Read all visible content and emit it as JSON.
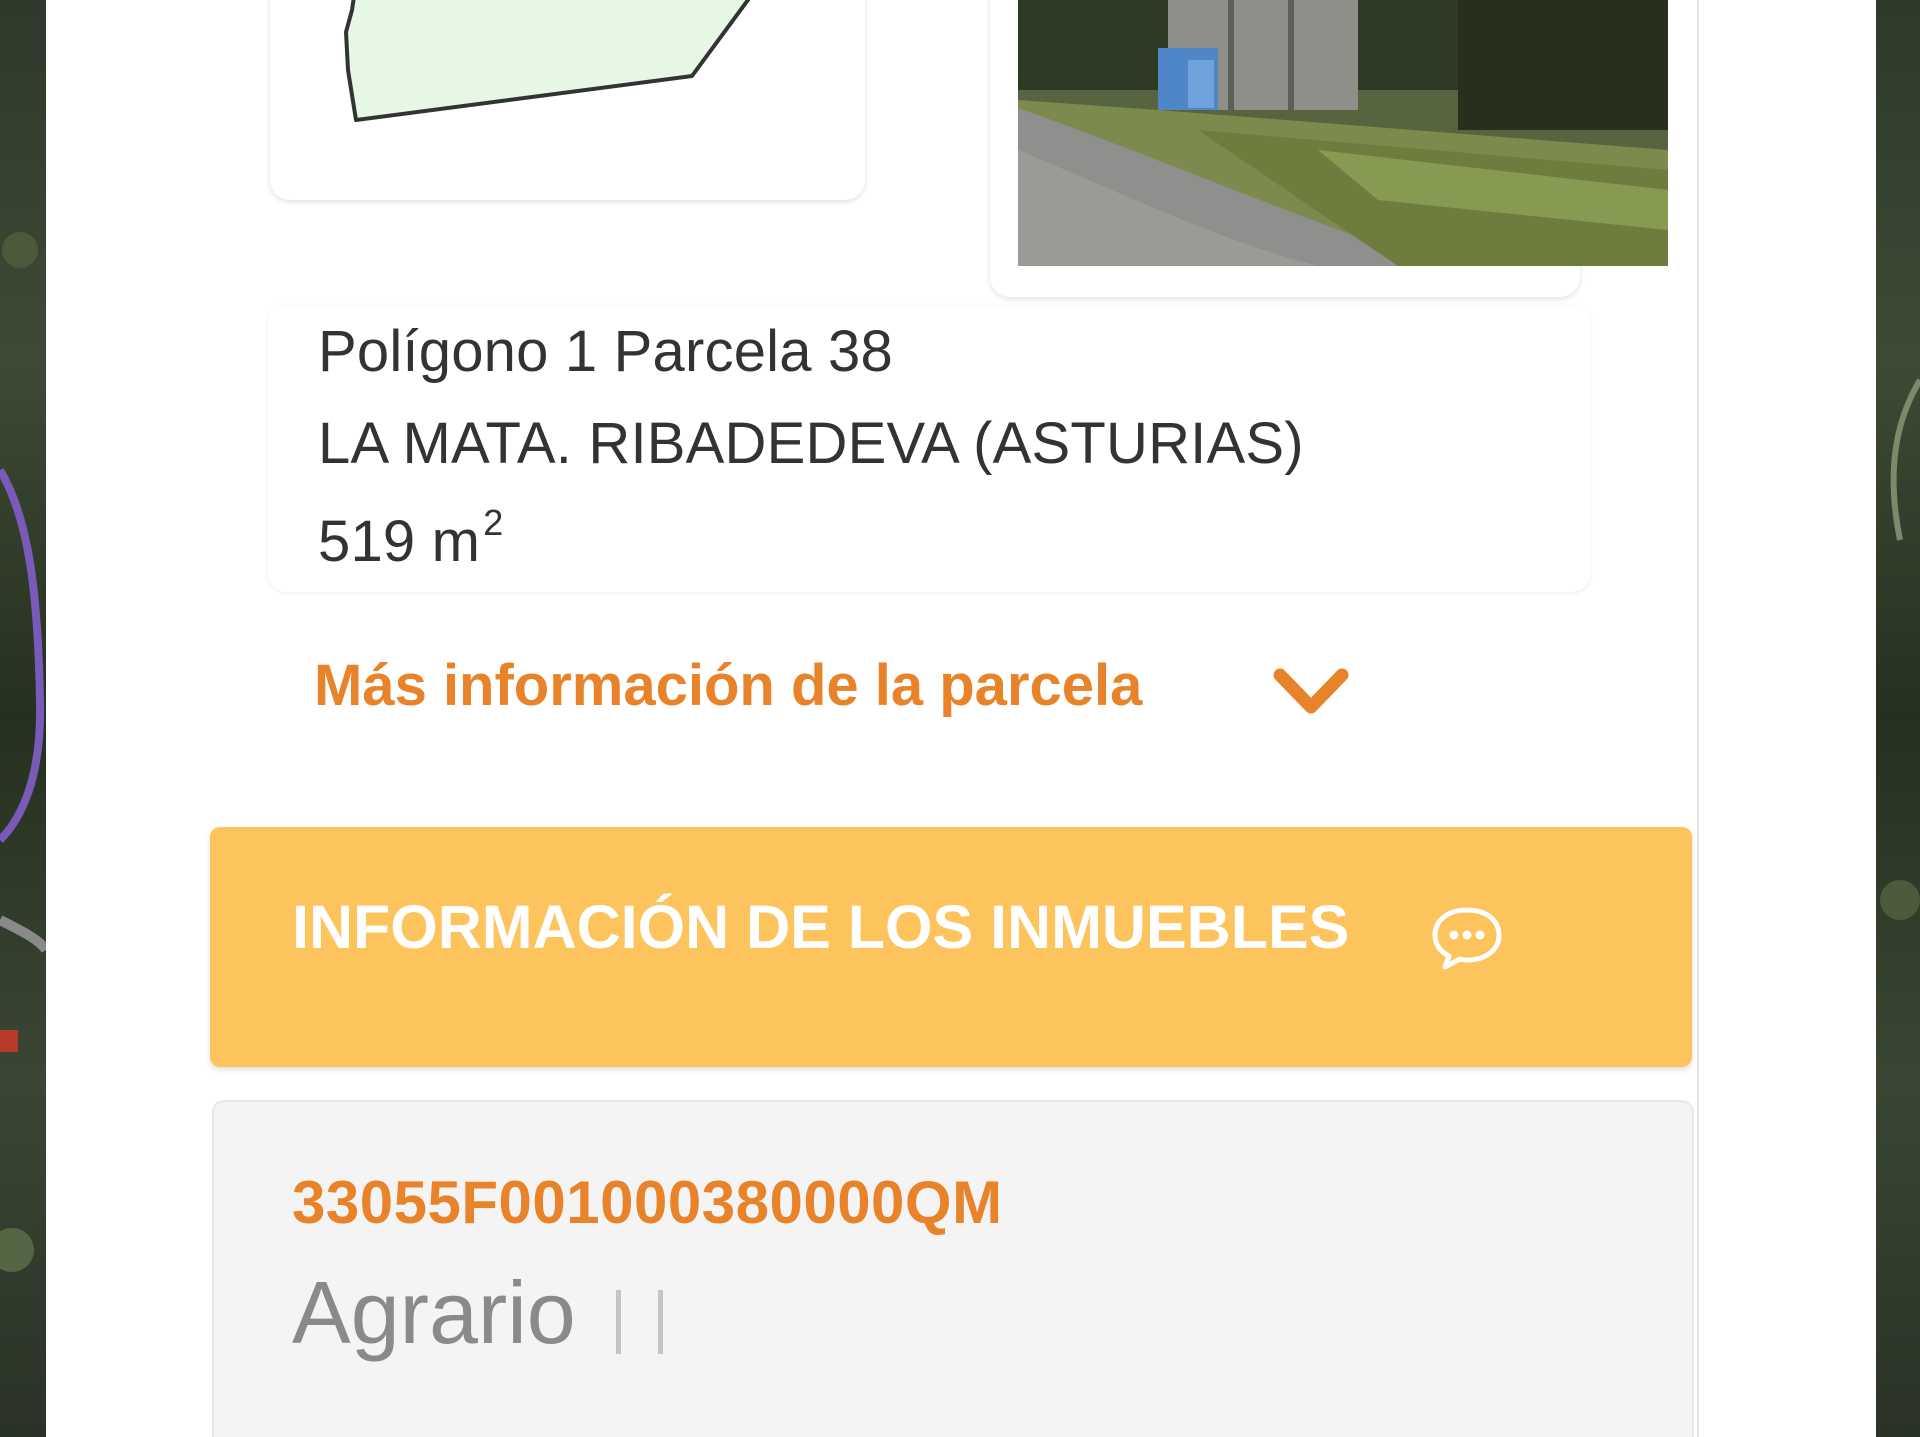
{
  "parcel": {
    "title": "Polígono 1 Parcela 38",
    "location": "LA MATA. RIBADEDEVA (ASTURIAS)",
    "area_value": "519 m",
    "area_exponent": "2"
  },
  "more_info": {
    "label": "Más información de la parcela"
  },
  "properties_section": {
    "title": "INFORMACIÓN DE LOS INMUEBLES"
  },
  "property": {
    "reference": "33055F001000380000QM",
    "use": "Agrario"
  },
  "colors": {
    "accent_orange": "#e8832a",
    "section_bar": "#fdc35c",
    "plot_fill": "#e6f7e6"
  },
  "icons": [
    "chevron-down-icon",
    "chat-bubble-icon"
  ]
}
